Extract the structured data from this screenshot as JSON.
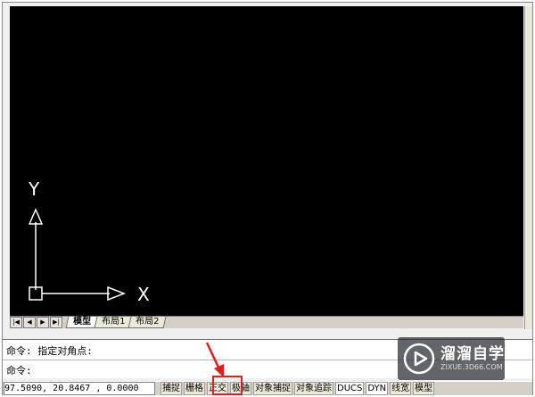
{
  "drawing": {
    "axis_y_label": "Y",
    "axis_x_label": "X"
  },
  "layout_tabs": {
    "nav_first": "|◀",
    "nav_prev": "◀",
    "nav_next": "▶",
    "nav_last": "▶|",
    "tabs": [
      "模型",
      "布局1",
      "布局2"
    ]
  },
  "command": {
    "line1": "命令: 指定对角点:",
    "line2": "命令:"
  },
  "status_bar": {
    "coordinates": "97.5090, 20.8467 , 0.0000",
    "buttons": [
      "捕捉",
      "栅格",
      "正交",
      "极轴",
      "对象捕捉",
      "对象追踪",
      "DUCS",
      "DYN",
      "线宽",
      "模型"
    ],
    "highlighted_button": "正交"
  },
  "annotation": {
    "color": "#e02020"
  },
  "watermark": {
    "title": "溜溜自学",
    "url": "ZIXUE.3D66.COM"
  }
}
